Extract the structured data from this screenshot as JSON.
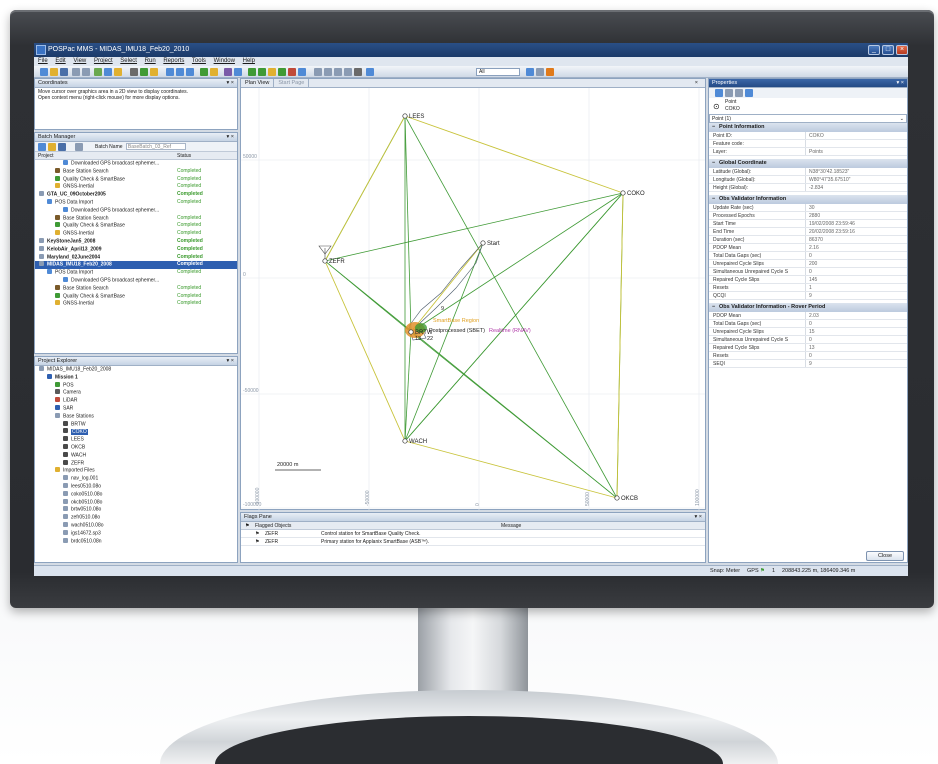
{
  "window": {
    "title": "POSPac MMS - MIDAS_IMU18_Feb20_2010"
  },
  "menu": [
    "File",
    "Edit",
    "View",
    "Project",
    "Select",
    "Run",
    "Reports",
    "Tools",
    "Window",
    "Help"
  ],
  "toolbar": {
    "filter_value": "All"
  },
  "coordinates_panel": {
    "title": "Coordinates",
    "line1": "Move cursor over graphics area in a 2D view to display coordinates.",
    "line2": "Open context menu (right-click mouse) for more display options."
  },
  "batch_manager": {
    "title": "Batch Manager",
    "batch_name_label": "Batch Name",
    "batch_name_value": "BaseBatch_03_Ref",
    "col_project": "Project",
    "col_status": "Status",
    "rows": [
      {
        "label": "Downloaded GPS broadcast ephemer...",
        "status": "",
        "indent": 3,
        "icon": "info-icon",
        "bold": false
      },
      {
        "label": "Base Station Search",
        "status": "Completed",
        "indent": 2,
        "icon": "search-icon",
        "bold": false
      },
      {
        "label": "Quality Check & SmartBase",
        "status": "Completed",
        "indent": 2,
        "icon": "check-icon",
        "bold": false
      },
      {
        "label": "GNSS-Inertial",
        "status": "Completed",
        "indent": 2,
        "icon": "star-icon",
        "bold": false
      },
      {
        "label": "GTA_UC_09October2005",
        "status": "Completed",
        "indent": 0,
        "icon": "project-icon",
        "bold": true
      },
      {
        "label": "POS Data Import",
        "status": "Completed",
        "indent": 1,
        "icon": "import-icon",
        "bold": false
      },
      {
        "label": "Downloaded GPS broadcast ephemer...",
        "status": "",
        "indent": 3,
        "icon": "info-icon",
        "bold": false
      },
      {
        "label": "Base Station Search",
        "status": "Completed",
        "indent": 2,
        "icon": "search-icon",
        "bold": false
      },
      {
        "label": "Quality Check & SmartBase",
        "status": "Completed",
        "indent": 2,
        "icon": "check-icon",
        "bold": false
      },
      {
        "label": "GNSS-Inertial",
        "status": "Completed",
        "indent": 2,
        "icon": "star-icon",
        "bold": false
      },
      {
        "label": "KeyStoneJan5_2008",
        "status": "Completed",
        "indent": 0,
        "icon": "project-icon",
        "bold": true
      },
      {
        "label": "KelobAir_April13_2009",
        "status": "Completed",
        "indent": 0,
        "icon": "project-icon",
        "bold": true
      },
      {
        "label": "Maryland_02June2004",
        "status": "Completed",
        "indent": 0,
        "icon": "project-icon",
        "bold": true
      },
      {
        "label": "MIDAS_IMU18_Feb20_2008",
        "status": "Completed",
        "indent": 0,
        "icon": "project-icon",
        "bold": true,
        "selected": true
      },
      {
        "label": "POS Data Import",
        "status": "Completed",
        "indent": 1,
        "icon": "import-icon",
        "bold": false
      },
      {
        "label": "Downloaded GPS broadcast ephemer...",
        "status": "",
        "indent": 3,
        "icon": "info-icon",
        "bold": false
      },
      {
        "label": "Base Station Search",
        "status": "Completed",
        "indent": 2,
        "icon": "search-icon",
        "bold": false
      },
      {
        "label": "Quality Check & SmartBase",
        "status": "Completed",
        "indent": 2,
        "icon": "check-icon",
        "bold": false
      },
      {
        "label": "GNSS-Inertial",
        "status": "Completed",
        "indent": 2,
        "icon": "star-icon",
        "bold": false
      }
    ]
  },
  "project_explorer": {
    "title": "Project Explorer",
    "items": [
      {
        "label": "MIDAS_IMU18_Feb20_2008",
        "indent": 0,
        "icon": "project-icon"
      },
      {
        "label": "Mission 1",
        "indent": 1,
        "icon": "mission-icon",
        "bold": true
      },
      {
        "label": "POS",
        "indent": 2,
        "icon": "pos-icon"
      },
      {
        "label": "Camera",
        "indent": 2,
        "icon": "camera-icon"
      },
      {
        "label": "LiDAR",
        "indent": 2,
        "icon": "lidar-icon"
      },
      {
        "label": "SAR",
        "indent": 2,
        "icon": "sar-icon"
      },
      {
        "label": "Base Stations",
        "indent": 2,
        "icon": "base-station-icon"
      },
      {
        "label": "BRTW",
        "indent": 3,
        "icon": "point-icon"
      },
      {
        "label": "COKO",
        "indent": 3,
        "icon": "point-icon",
        "selected": true
      },
      {
        "label": "LEES",
        "indent": 3,
        "icon": "point-icon"
      },
      {
        "label": "OKCB",
        "indent": 3,
        "icon": "point-icon"
      },
      {
        "label": "WACH",
        "indent": 3,
        "icon": "point-icon"
      },
      {
        "label": "ZEFR",
        "indent": 3,
        "icon": "point-icon"
      },
      {
        "label": "Imported Files",
        "indent": 2,
        "icon": "folder-icon"
      },
      {
        "label": "nav_log.001",
        "indent": 3,
        "icon": "file-icon"
      },
      {
        "label": "lees0510.08o",
        "indent": 3,
        "icon": "file-icon"
      },
      {
        "label": "coko0510.08o",
        "indent": 3,
        "icon": "file-icon"
      },
      {
        "label": "okcb0510.08o",
        "indent": 3,
        "icon": "file-icon"
      },
      {
        "label": "brtw0510.08o",
        "indent": 3,
        "icon": "file-icon"
      },
      {
        "label": "zefr0510.08o",
        "indent": 3,
        "icon": "file-icon"
      },
      {
        "label": "wach0510.08o",
        "indent": 3,
        "icon": "file-icon"
      },
      {
        "label": "igs14672.sp3",
        "indent": 3,
        "icon": "file-icon"
      },
      {
        "label": "brdc0510.08n",
        "indent": 3,
        "icon": "file-icon"
      }
    ]
  },
  "plan_view": {
    "tab_active": "Plan View",
    "tab_inactive": "Start Page",
    "y_ticks": [
      "50000",
      "0",
      "-50000",
      "-100000"
    ],
    "x_ticks": [
      "-100000",
      "-50000",
      "0",
      "50000",
      "100000"
    ],
    "scale_label": "20000 m",
    "stations": [
      "LEES",
      "COKO",
      "ZEFR",
      "Start",
      "BRTW",
      "WACH",
      "OKCB"
    ],
    "legend_smartbase": "SmartBase Region",
    "legend_postprocessed": "Postprocessed (SBET)",
    "legend_realtime": "Realtime (RNAV)",
    "marker_labels": [
      "9",
      "13",
      "22"
    ]
  },
  "flags_pane": {
    "title": "Flags Pane",
    "col_objects": "Flagged Objects",
    "col_message": "Message",
    "rows": [
      {
        "object": "ZEFR",
        "message": "Control station for SmartBase Quality Check."
      },
      {
        "object": "ZEFR",
        "message": "Primary station for Applanix SmartBase (ASB™)."
      }
    ]
  },
  "properties": {
    "title": "Properties",
    "point_type": "Point",
    "point_name": "COKO",
    "dropdown": "Point (1)",
    "sections": [
      {
        "title": "Point Information",
        "rows": [
          [
            "Point ID:",
            "COKO"
          ],
          [
            "Feature code:",
            ""
          ],
          [
            "Layer:",
            "Points"
          ]
        ]
      },
      {
        "title": "Global Coordinate",
        "rows": [
          [
            "Latitude (Global):",
            "N38°30'42.18523\""
          ],
          [
            "Longitude (Global):",
            "W80°47'35.67510\""
          ],
          [
            "Height (Global):",
            "-2.834"
          ]
        ]
      },
      {
        "title": "Obs Validator Information",
        "rows": [
          [
            "Update Rate (sec)",
            "30"
          ],
          [
            "Processed Epochs",
            "2880"
          ],
          [
            "Start Time",
            "19/02/2008 23:59:46"
          ],
          [
            "End Time",
            "20/02/2008 23:59:16"
          ],
          [
            "Duration (sec)",
            "86370"
          ],
          [
            "PDOP Mean",
            "2.16"
          ],
          [
            "Total Data Gaps (sec)",
            "0"
          ],
          [
            "Unrepaired Cycle Slips",
            "200"
          ],
          [
            "Simultaneous Unrepaired Cycle S",
            "0"
          ],
          [
            "Repaired Cycle Slips",
            "145"
          ],
          [
            "Resets",
            "1"
          ],
          [
            "QCQI",
            "9"
          ]
        ]
      },
      {
        "title": "Obs Validator Information - Rover Period",
        "rows": [
          [
            "PDOP Mean",
            "2.03"
          ],
          [
            "Total Data Gaps (sec)",
            "0"
          ],
          [
            "Unrepaired Cycle Slips",
            "15"
          ],
          [
            "Simultaneous Unrepaired Cycle S",
            "0"
          ],
          [
            "Repaired Cycle Slips",
            "13"
          ],
          [
            "Resets",
            "0"
          ],
          [
            "SEQI",
            "9"
          ]
        ]
      }
    ],
    "close_label": "Close"
  },
  "status_bar": {
    "snap": "Snap:",
    "snap_value": "Meter",
    "gps": "GPS",
    "count": "1",
    "coords": "208843.225 m, 186409.346 m"
  },
  "colors": {
    "green_lines": "#3f9a35",
    "yellow_lines": "#c8c33a",
    "selection": "#2e5fb0",
    "titlebar": "#1b3a69"
  }
}
